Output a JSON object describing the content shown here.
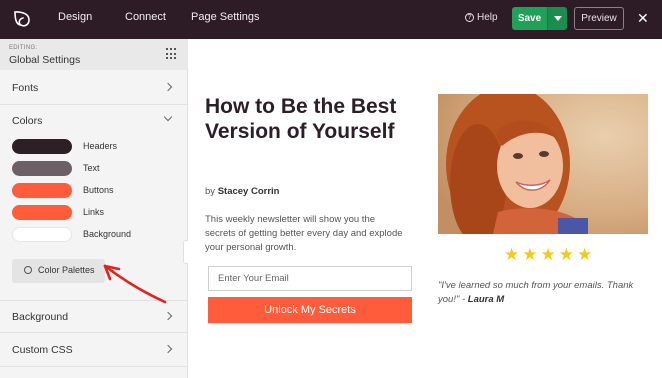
{
  "topbar": {
    "nav": [
      "Design",
      "Connect",
      "Page Settings"
    ],
    "help_label": "Help",
    "save_label": "Save",
    "preview_label": "Preview",
    "close_glyph": "✕"
  },
  "sidebar": {
    "editing_label": "EDITING:",
    "editing_title": "Global Settings",
    "sections": {
      "fonts": "Fonts",
      "colors": "Colors",
      "background": "Background",
      "custom_css": "Custom CSS"
    },
    "colors": [
      {
        "label": "Headers",
        "color": "#2d1f26"
      },
      {
        "label": "Text",
        "color": "#6e5f66"
      },
      {
        "label": "Buttons",
        "color": "#ff5c3b"
      },
      {
        "label": "Links",
        "color": "#ff5c3b"
      },
      {
        "label": "Background",
        "color": "#ffffff"
      }
    ],
    "palettes_label": "Color Palettes"
  },
  "page": {
    "headline": "How to Be the Best Version of Yourself",
    "byline_prefix": "by ",
    "author": "Stacey Corrin",
    "description": "This weekly newsletter will show you the secrets of getting better every day and explode your personal growth.",
    "email_placeholder": "Enter Your Email",
    "cta_label": "Unlock My Secrets",
    "rating_stars": 5,
    "quote": "\"I've learned so much from your emails. Thank you!\"",
    "quote_separator": " - ",
    "quote_author": "Laura M"
  },
  "icons": {
    "logo": "seedprod-leaf-icon",
    "help": "help-circle-icon",
    "grid": "grid-dots-icon",
    "palette": "palette-icon",
    "star": "star-icon"
  },
  "colors": {
    "topbar": "#2d1c26",
    "save_green": "#20a15a",
    "accent": "#ff5c3b",
    "star": "#f6c81d"
  }
}
